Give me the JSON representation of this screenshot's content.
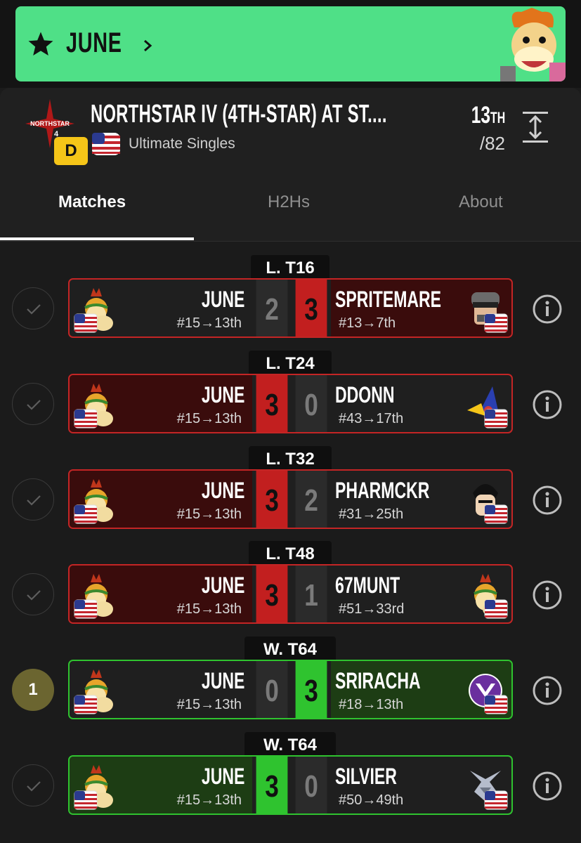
{
  "player": {
    "name": "JUNE"
  },
  "event": {
    "title": "NORTHSTAR IV (4TH-STAR) AT ST....",
    "tier": "D",
    "game": "Ultimate Singles",
    "placement_num": "13",
    "placement_suffix": "TH",
    "entrants": "/82",
    "logo_text": "NORTHSTAR",
    "logo_num": "4"
  },
  "tabs": [
    "Matches",
    "H2Hs",
    "About"
  ],
  "matches": [
    {
      "round": "L. T16",
      "status": "check",
      "left_name": "JUNE",
      "left_seed": "#15→13th",
      "left_score": "2",
      "right_name": "SPRITEMARE",
      "right_seed": "#13→7th",
      "right_score": "3",
      "result": "loss"
    },
    {
      "round": "L. T24",
      "status": "check",
      "left_name": "JUNE",
      "left_seed": "#15→13th",
      "left_score": "3",
      "right_name": "DDONN",
      "right_seed": "#43→17th",
      "right_score": "0",
      "result": "win"
    },
    {
      "round": "L. T32",
      "status": "check",
      "left_name": "JUNE",
      "left_seed": "#15→13th",
      "left_score": "3",
      "right_name": "PHARMCKR",
      "right_seed": "#31→25th",
      "right_score": "2",
      "result": "win"
    },
    {
      "round": "L. T48",
      "status": "check",
      "left_name": "JUNE",
      "left_seed": "#15→13th",
      "left_score": "3",
      "right_name": "67MUNT",
      "right_seed": "#51→33rd",
      "right_score": "1",
      "result": "win"
    },
    {
      "round": "W. T64",
      "status": "1",
      "left_name": "JUNE",
      "left_seed": "#15→13th",
      "left_score": "0",
      "right_name": "SRIRACHA",
      "right_seed": "#18→13th",
      "right_score": "3",
      "result": "loss"
    },
    {
      "round": "W. T64",
      "status": "check",
      "left_name": "JUNE",
      "left_seed": "#15→13th",
      "left_score": "3",
      "right_name": "SILVIER",
      "right_seed": "#50→49th",
      "right_score": "0",
      "result": "win"
    }
  ],
  "colors": {
    "banner": "#4fe087",
    "loss": "#c21f1f",
    "win": "#2fc32f",
    "tier": "#f5c518"
  }
}
